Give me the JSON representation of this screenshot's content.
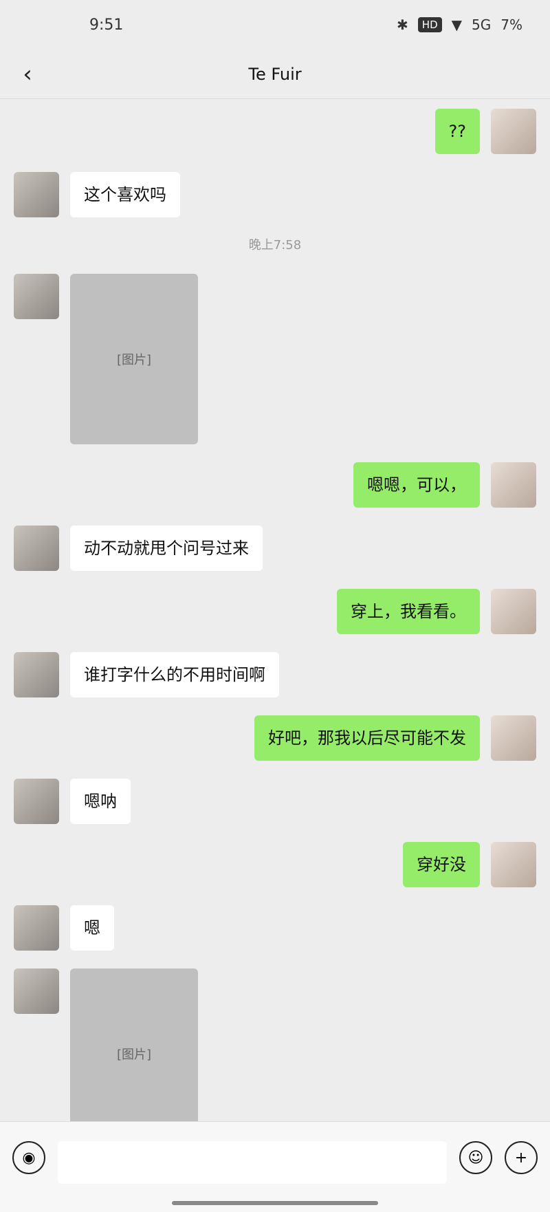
{
  "status": {
    "time": "9:51",
    "battery": "7%",
    "network": "5G",
    "hd": "HD"
  },
  "header": {
    "title": "Te Fuir",
    "back_icon": "chevron-left-icon"
  },
  "messages": [
    {
      "side": "right",
      "text": "??"
    },
    {
      "side": "left",
      "text": "这个喜欢吗"
    },
    {
      "type": "time",
      "text": "晚上7:58"
    },
    {
      "side": "left",
      "type": "photo",
      "text": "[图片]"
    },
    {
      "side": "right",
      "text": "嗯嗯，可以，"
    },
    {
      "side": "left",
      "text": "动不动就甩个问号过来"
    },
    {
      "side": "right",
      "text": "穿上，我看看。"
    },
    {
      "side": "left",
      "text": "谁打字什么的不用时间啊"
    },
    {
      "side": "right",
      "text": "好吧，那我以后尽可能不发"
    },
    {
      "side": "left",
      "text": "嗯呐"
    },
    {
      "side": "right",
      "text": "穿好没"
    },
    {
      "side": "left",
      "text": "嗯"
    },
    {
      "side": "left",
      "type": "photo",
      "text": "[图片]"
    }
  ],
  "input": {
    "placeholder": ""
  }
}
